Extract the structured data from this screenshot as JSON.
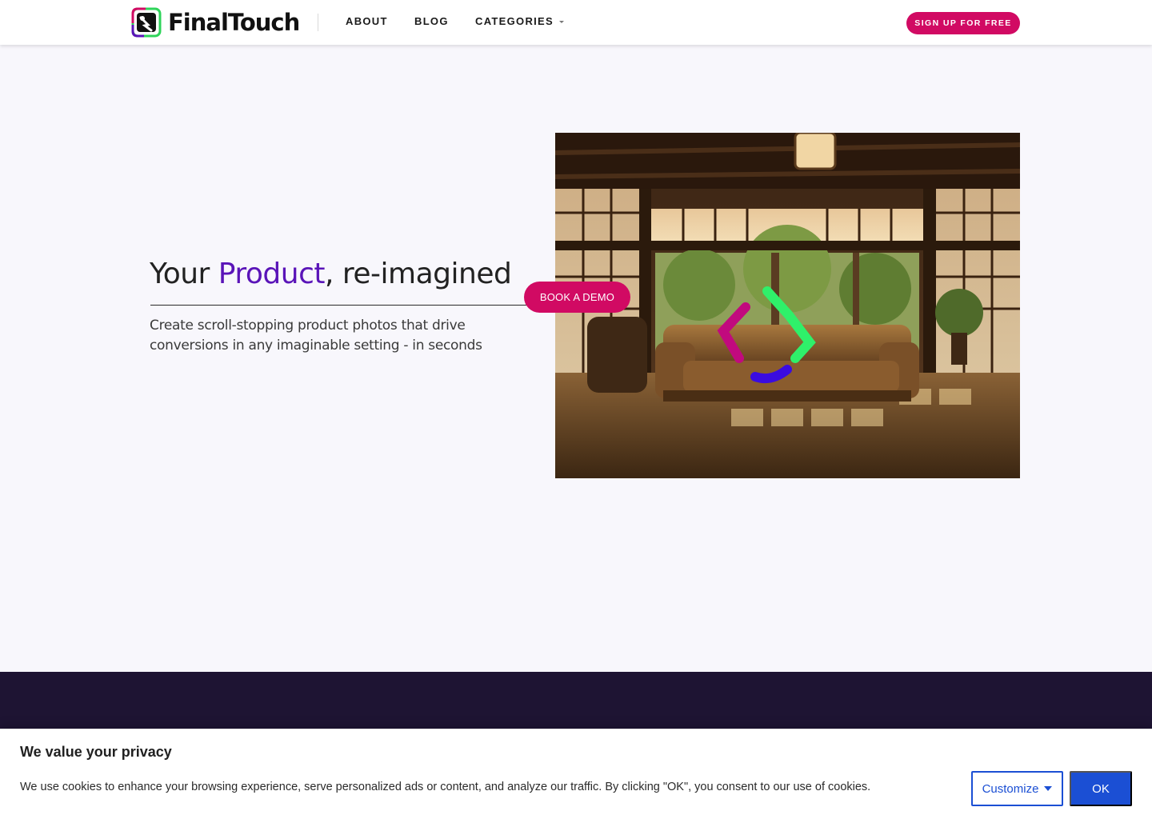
{
  "header": {
    "logo_text": "FinalTouch",
    "nav": {
      "about": "ABOUT",
      "blog": "BLOG",
      "categories": "CATEGORIES"
    },
    "signup_label": "SIGN UP FOR FREE"
  },
  "hero": {
    "title_before": "Your ",
    "title_accent": "Product",
    "title_after": ", re-imagined",
    "subtitle": "Create scroll-stopping product photos that drive conversions in any imaginable setting - in seconds",
    "demo_label": "BOOK A DEMO"
  },
  "cookie": {
    "title": "We value your privacy",
    "text": "We use cookies to enhance your browsing experience, serve personalized ads or content, and analyze our traffic. By clicking \"OK\", you consent to our use of cookies.",
    "customize_label": "Customize",
    "ok_label": "OK"
  },
  "colors": {
    "brand_pink": "#d10a63",
    "brand_purple": "#5a14b8",
    "dark_band": "#1e1433",
    "cookie_blue": "#1b4fd4"
  }
}
